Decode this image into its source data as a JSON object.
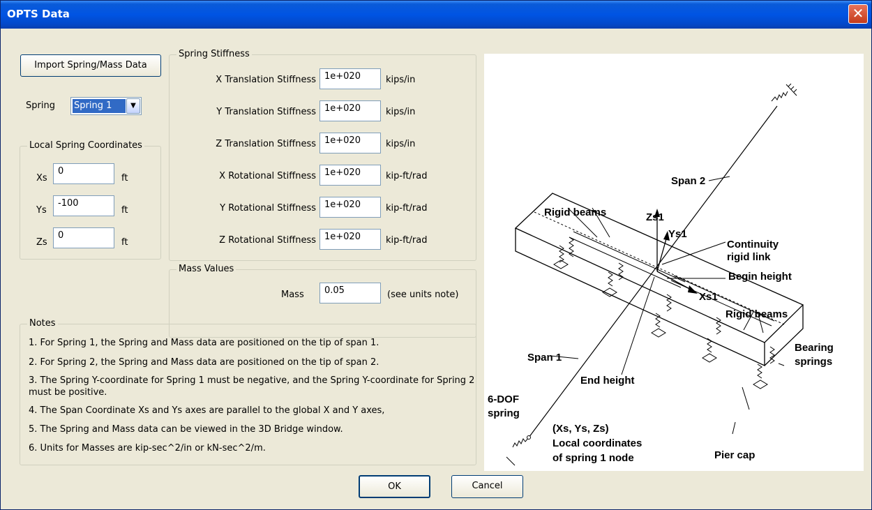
{
  "window": {
    "title": "OPTS Data",
    "close_symbol": "✕"
  },
  "import_button": "Import Spring/Mass Data",
  "spring": {
    "label": "Spring",
    "selected": "Spring 1",
    "dropdown_symbol": "▼"
  },
  "local_coords": {
    "legend": "Local Spring Coordinates",
    "rows": [
      {
        "label": "Xs",
        "value": "0",
        "unit": "ft"
      },
      {
        "label": "Ys",
        "value": "-100",
        "unit": "ft"
      },
      {
        "label": "Zs",
        "value": "0",
        "unit": "ft"
      }
    ]
  },
  "stiffness": {
    "legend": "Spring Stiffness",
    "rows": [
      {
        "label": "X Translation Stiffness",
        "value": "1e+020",
        "unit": "kips/in"
      },
      {
        "label": "Y Translation Stiffness",
        "value": "1e+020",
        "unit": "kips/in"
      },
      {
        "label": "Z Translation Stiffness",
        "value": "1e+020",
        "unit": "kips/in"
      },
      {
        "label": "X Rotational Stiffness",
        "value": "1e+020",
        "unit": "kip-ft/rad"
      },
      {
        "label": "Y Rotational Stiffness",
        "value": "1e+020",
        "unit": "kip-ft/rad"
      },
      {
        "label": "Z Rotational Stiffness",
        "value": "1e+020",
        "unit": "kip-ft/rad"
      }
    ]
  },
  "mass": {
    "legend": "Mass Values",
    "label": "Mass",
    "value": "0.05",
    "unit": "(see units note)"
  },
  "notes": {
    "legend": "Notes",
    "items": [
      "1. For Spring 1, the Spring and Mass data are positioned on the tip of span 1.",
      "2. For Spring 2, the Spring and Mass data are positioned on the tip of span 2.",
      "3. The Spring Y-coordinate for Spring 1 must be negative, and the Spring Y-coordinate for Spring 2 must be positive.",
      "4. The Span Coordinate Xs and Ys axes are parallel to the global X and Y axes,",
      "5. The Spring and Mass data can be viewed in the 3D Bridge window.",
      "6. Units for Masses are kip-sec^2/in or kN-sec^2/m."
    ]
  },
  "diagram": {
    "span2": "Span 2",
    "rigid_beams_top": "Rigid beams",
    "zs1": "Zs1",
    "ys1": "Ys1",
    "continuity_1": "Continuity",
    "continuity_2": "rigid link",
    "begin_height": "Begin height",
    "xs1": "Xs1",
    "rigid_beams_right": "Rigid beams",
    "bearing_1": "Bearing",
    "bearing_2": "springs",
    "span1": "Span 1",
    "end_height": "End height",
    "dof_1": "6-DOF",
    "dof_2": "spring",
    "coords_1": "(Xs, Ys, Zs)",
    "coords_2": "Local coordinates",
    "coords_3": "of spring 1 node",
    "pier_cap": "Pier cap"
  },
  "ok_button": "OK",
  "cancel_button": "Cancel"
}
